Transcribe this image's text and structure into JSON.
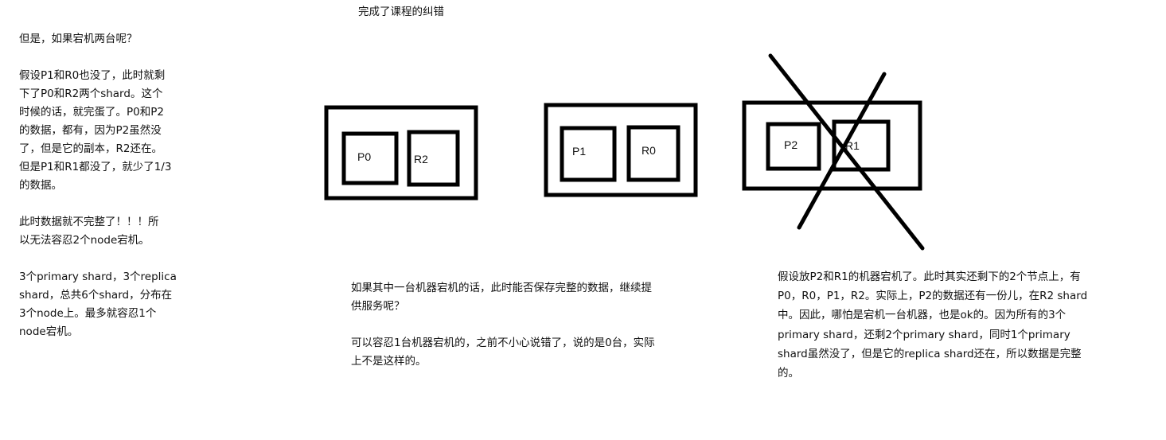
{
  "title_note": "完成了课程的纠错",
  "left_notes": "但是，如果宕机两台呢？\n\n假设P1和R0也没了，此时就剩\n下了P0和R2两个shard。这个\n时候的话，就完蛋了。P0和P2\n的数据，都有，因为P2虽然没\n了，但是它的副本，R2还在。\n但是P1和R1都没了，就少了1/3\n的数据。\n\n此时数据就不完整了！！！所\n以无法容忍2个node宕机。\n\n3个primary shard，3个replica\nshard，总共6个shard，分布在\n3个node上。最多就容忍1个\nnode宕机。",
  "middle_notes": "如果其中一台机器宕机的话，此时能否保存完整的数据，继续提\n供服务呢？\n\n可以容忍1台机器宕机的，之前不小心说错了，说的是0台，实际\n上不是这样的。",
  "right_notes": "假设放P2和R1的机器宕机了。此时其实还剩下的2个节点上，有\nP0，R0，P1，R2。实际上，P2的数据还有一份儿，在R2 shard\n中。因此，哪怕是宕机一台机器，也是ok的。因为所有的3个\nprimary shard，还剩2个primary shard，同时1个primary\nshard虽然没了，但是它的replica shard还在，所以数据是完整\n的。",
  "nodes": [
    {
      "shards": [
        "P0",
        "R2"
      ],
      "crossed_out": false
    },
    {
      "shards": [
        "P1",
        "R0"
      ],
      "crossed_out": false
    },
    {
      "shards": [
        "P2",
        "R1"
      ],
      "crossed_out": true
    }
  ]
}
